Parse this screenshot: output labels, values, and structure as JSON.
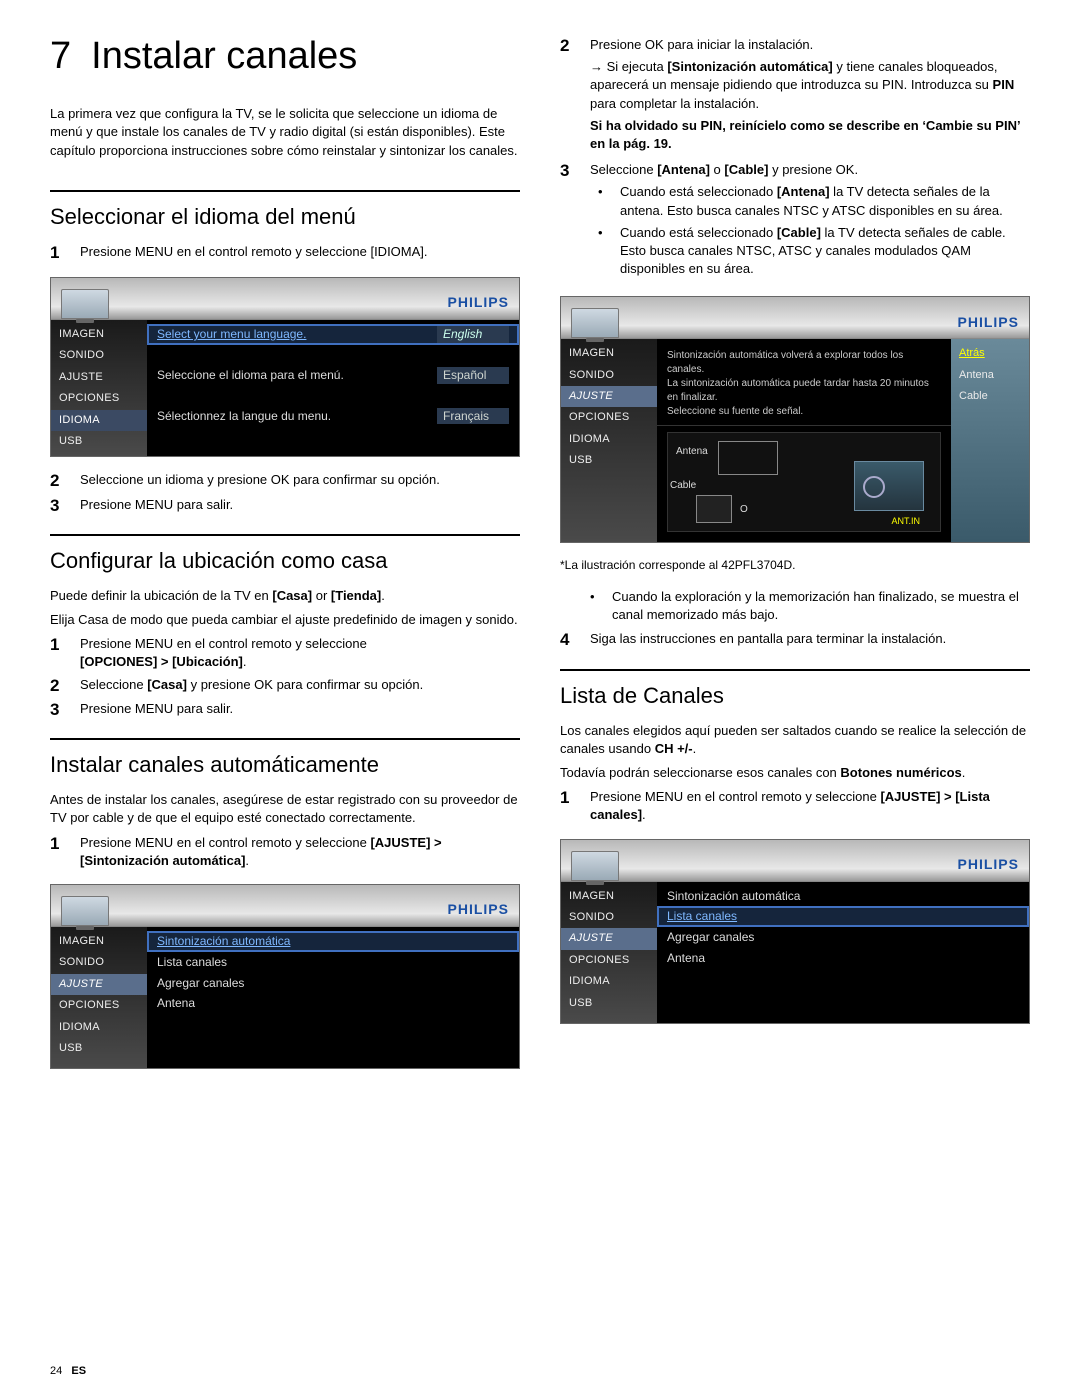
{
  "footer": {
    "page": "24",
    "lang": "ES"
  },
  "chapter": {
    "num": "7",
    "title": "Instalar canales"
  },
  "intro": "La primera vez que configura la TV, se le solicita que seleccione un idioma de menú y que instale los canales de TV y radio digital (si están disponibles). Este capítulo proporciona instrucciones sobre cómo reinstalar y sintonizar los canales.",
  "brand": "PHILIPS",
  "menu_side": [
    "IMAGEN",
    "SONIDO",
    "AJUSTE",
    "OPCIONES",
    "IDIOMA",
    "USB"
  ],
  "s1": {
    "heading": "Seleccionar el idioma del menú",
    "step1": "Presione MENU en el control remoto y seleccione [IDIOMA].",
    "step2": "Seleccione un idioma y presione OK para confirmar su opción.",
    "step3": "Presione MENU para salir.",
    "rows": [
      {
        "lab": "Select your menu language.",
        "val": "English"
      },
      {
        "lab": "Seleccione el idioma para el menú.",
        "val": "Español"
      },
      {
        "lab": "Sélectionnez la langue du menu.",
        "val": "Français"
      }
    ]
  },
  "s2": {
    "heading": "Configurar la ubicación como casa",
    "p1a": "Puede definir la ubicación de la TV en ",
    "p1b": "[Casa]",
    "p1c": " or ",
    "p1d": "[Tienda]",
    "p1e": ".",
    "p2": "Elija Casa de modo que pueda cambiar el ajuste predefinido de imagen y sonido.",
    "step1a": "Presione MENU en el control remoto y seleccione ",
    "step1b": "[OPCIONES] > [Ubicación]",
    "step1c": ".",
    "step2a": "Seleccione ",
    "step2b": "[Casa]",
    "step2c": " y presione OK para confirmar su opción.",
    "step3": "Presione MENU para salir."
  },
  "s3": {
    "heading": "Instalar canales automáticamente",
    "p1": "Antes de instalar los canales, asegúrese de estar registrado con su proveedor de TV por cable y de que el equipo esté conectado correctamente.",
    "step1a": "Presione MENU en el control remoto y seleccione ",
    "step1b": "[AJUSTE] > [Sintonización automática]",
    "step1c": ".",
    "rows": [
      "Sintonización automática",
      "Lista canales",
      "Agregar canales",
      "Antena"
    ]
  },
  "r": {
    "step2": "Presione OK para iniciar la instalación.",
    "step2b_a": "Si ejecuta ",
    "step2b_b": "[Sintonización automática]",
    "step2b_c": " y tiene canales bloqueados, aparecerá un mensaje pidiendo que introduzca su PIN. Introduzca su ",
    "step2b_d": "PIN",
    "step2b_e": " para completar la instalación.",
    "step2c": "Si ha olvidado su PIN, reinícielo como se describe en ‘Cambie su PIN’ en la pág. 19.",
    "step3_a": "Seleccione ",
    "step3_b": "[Antena]",
    "step3_c": " o ",
    "step3_d": "[Cable]",
    "step3_e": " y presione OK.",
    "bul1_a": "Cuando está seleccionado ",
    "bul1_b": "[Antena]",
    "bul1_c": " la TV detecta señales de la antena. Esto busca canales NTSC y ATSC disponibles en su área.",
    "bul2_a": "Cuando está seleccionado ",
    "bul2_b": "[Cable]",
    "bul2_c": " la TV detecta señales de cable. Esto busca canales NTSC, ATSC y canales modulados QAM disponibles en su área.",
    "tv_desc_line1": "Sintonización automática volverá a explorar todos los canales.",
    "tv_desc_line2": "La sintonización automática puede tardar hasta 20 minutos en finalizar.",
    "tv_desc_line3": "Seleccione su fuente de señal.",
    "right_items": [
      "Atrás",
      "Antena",
      "Cable"
    ],
    "diag": {
      "antena": "Antena",
      "cable": "Cable",
      "o": "O",
      "antin": "ANT.IN"
    },
    "caption": "*La ilustración corresponde al 42PFL3704D.",
    "bul3": "Cuando la exploración y la memorización han finalizado, se muestra el canal memorizado más bajo.",
    "step4": "Siga las instrucciones en pantalla para terminar la instalación."
  },
  "s4": {
    "heading": "Lista de Canales",
    "p1_a": "Los canales elegidos aquí pueden ser saltados cuando se realice la selección de canales usando ",
    "p1_b": "CH +/-",
    "p1_c": ".",
    "p2_a": "Todavía podrán seleccionarse esos canales con ",
    "p2_b": "Botones numéricos",
    "p2_c": ".",
    "step1_a": "Presione MENU en el control remoto y seleccione ",
    "step1_b": "[AJUSTE] > [Lista canales]",
    "step1_c": ".",
    "rows": [
      "Sintonización automática",
      "Lista canales",
      "Agregar canales",
      "Antena"
    ]
  }
}
